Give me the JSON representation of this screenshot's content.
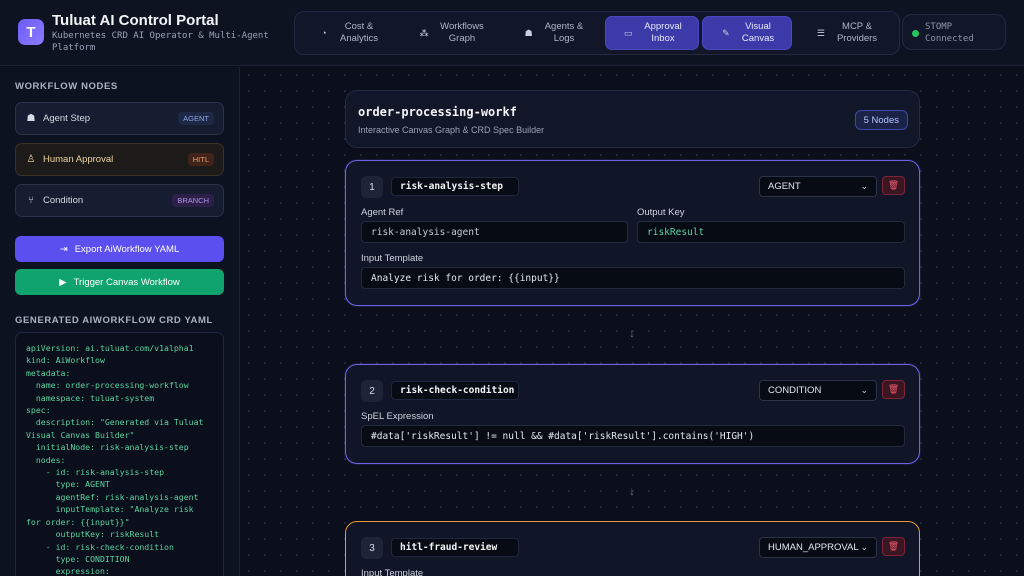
{
  "app": {
    "logo_letter": "T",
    "title": "Tuluat AI Control Portal",
    "subtitle": "Kubernetes CRD AI Operator & Multi-Agent Platform"
  },
  "nav": {
    "items": [
      {
        "label_line1": "Cost &",
        "label_line2": "Analytics",
        "icon": "pie-chart-icon",
        "glyph": "◔",
        "active": false
      },
      {
        "label_line1": "Workflows",
        "label_line2": "Graph",
        "icon": "graph-icon",
        "glyph": "⁂",
        "active": false
      },
      {
        "label_line1": "Agents &",
        "label_line2": "Logs",
        "icon": "robot-icon",
        "glyph": "☗",
        "active": false
      },
      {
        "label_line1": "Approval",
        "label_line2": "Inbox",
        "icon": "inbox-icon",
        "glyph": "▭",
        "active": true
      },
      {
        "label_line1": "Visual",
        "label_line2": "Canvas",
        "icon": "magic-wand-icon",
        "glyph": "✎",
        "active": true
      },
      {
        "label_line1": "MCP &",
        "label_line2": "Providers",
        "icon": "server-icon",
        "glyph": "☰",
        "active": false
      }
    ]
  },
  "status": {
    "line1": "STOMP",
    "line2": "Connected",
    "color": "#22c55e"
  },
  "sidebar": {
    "nodes_title": "WORKFLOW NODES",
    "nodes": [
      {
        "label": "Agent Step",
        "tag": "AGENT",
        "icon": "robot-icon",
        "glyph": "☗"
      },
      {
        "label": "Human Approval",
        "tag": "HITL",
        "icon": "user-check-icon",
        "glyph": "♙"
      },
      {
        "label": "Condition",
        "tag": "BRANCH",
        "icon": "branch-icon",
        "glyph": "⑂"
      }
    ],
    "export_label": "Export AiWorkflow YAML",
    "trigger_label": "Trigger Canvas Workflow",
    "yaml_title": "GENERATED AIWORKFLOW CRD YAML",
    "yaml": "apiVersion: ai.tuluat.com/v1alpha1\nkind: AiWorkflow\nmetadata:\n  name: order-processing-workflow\n  namespace: tuluat-system\nspec:\n  description: \"Generated via Tuluat Visual Canvas Builder\"\n  initialNode: risk-analysis-step\n  nodes:\n    - id: risk-analysis-step\n      type: AGENT\n      agentRef: risk-analysis-agent\n      inputTemplate: \"Analyze risk for order: {{input}}\"\n      outputKey: riskResult\n    - id: risk-check-condition\n      type: CONDITION\n      expression: \"#data['riskResult'] != null && #data['riskResult'].contains('HIGH')\""
  },
  "workflow": {
    "name": "order-processing-workflow",
    "subtitle": "Interactive Canvas Graph & CRD Spec Builder",
    "node_count": "5 Nodes"
  },
  "steps": [
    {
      "num": "1",
      "id": "risk-analysis-step",
      "type": "AGENT",
      "agent_ref_label": "Agent Ref",
      "agent_ref": "risk-analysis-agent",
      "output_key_label": "Output Key",
      "output_key": "riskResult",
      "input_template_label": "Input Template",
      "input_template": "Analyze risk for order: {{input}}"
    },
    {
      "num": "2",
      "id": "risk-check-condition",
      "type": "CONDITION",
      "expression_label": "SpEL Expression",
      "expression": "#data['riskResult'] != null && #data['riskResult'].contains('HIGH')"
    },
    {
      "num": "3",
      "id": "hitl-fraud-review",
      "type": "HUMAN_APPROVAL",
      "input_template_label": "Input Template"
    }
  ],
  "icons": {
    "delete": "trash-icon",
    "connector": "arrow-down-icon",
    "chevron": "chevron-down-icon"
  },
  "colors": {
    "accent": "#5b4ff0",
    "success": "#10a36d",
    "card_border_active": "#6c63e6",
    "card_border_hitl": "#e79a35",
    "danger": "#f05a6e"
  }
}
